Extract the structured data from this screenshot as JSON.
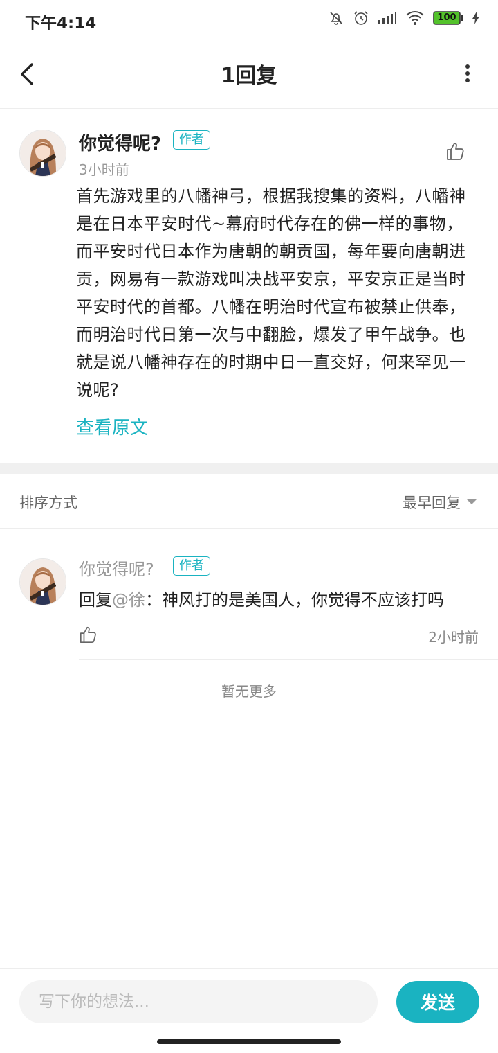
{
  "status_bar": {
    "time": "下午4:14",
    "battery": "100",
    "icons": [
      "mute-icon",
      "alarm-icon",
      "signal-icon",
      "wifi-icon",
      "battery-icon",
      "charging-icon"
    ]
  },
  "header": {
    "title": "1回复",
    "back_icon": "chevron-left-icon",
    "more_icon": "more-vertical-icon"
  },
  "post": {
    "author": "你觉得呢?",
    "author_tag": "作者",
    "time": "3小时前",
    "body": "首先游戏里的八幡神弓，根据我搜集的资料，八幡神是在日本平安时代~幕府时代存在的佛一样的事物，而平安时代日本作为唐朝的朝贡国，每年要向唐朝进贡，网易有一款游戏叫决战平安京，平安京正是当时平安时代的首都。八幡在明治时代宣布被禁止供奉，而明治时代日第一次与中翻脸，爆发了甲午战争。也就是说八幡神存在的时期中日一直交好，何来罕见一说呢?",
    "view_original": "查看原文"
  },
  "sort": {
    "label": "排序方式",
    "value": "最早回复"
  },
  "replies": [
    {
      "author": "你觉得呢?",
      "author_tag": "作者",
      "prefix": "回复",
      "mention": "@徐",
      "text": "：神风打的是美国人，你觉得不应该打吗",
      "time": "2小时前"
    }
  ],
  "footer_note": "暂无更多",
  "composer": {
    "placeholder": "写下你的想法...",
    "value": "",
    "send_label": "发送"
  },
  "colors": {
    "accent": "#1ab3c1",
    "text": "#222222",
    "muted": "#999999"
  }
}
